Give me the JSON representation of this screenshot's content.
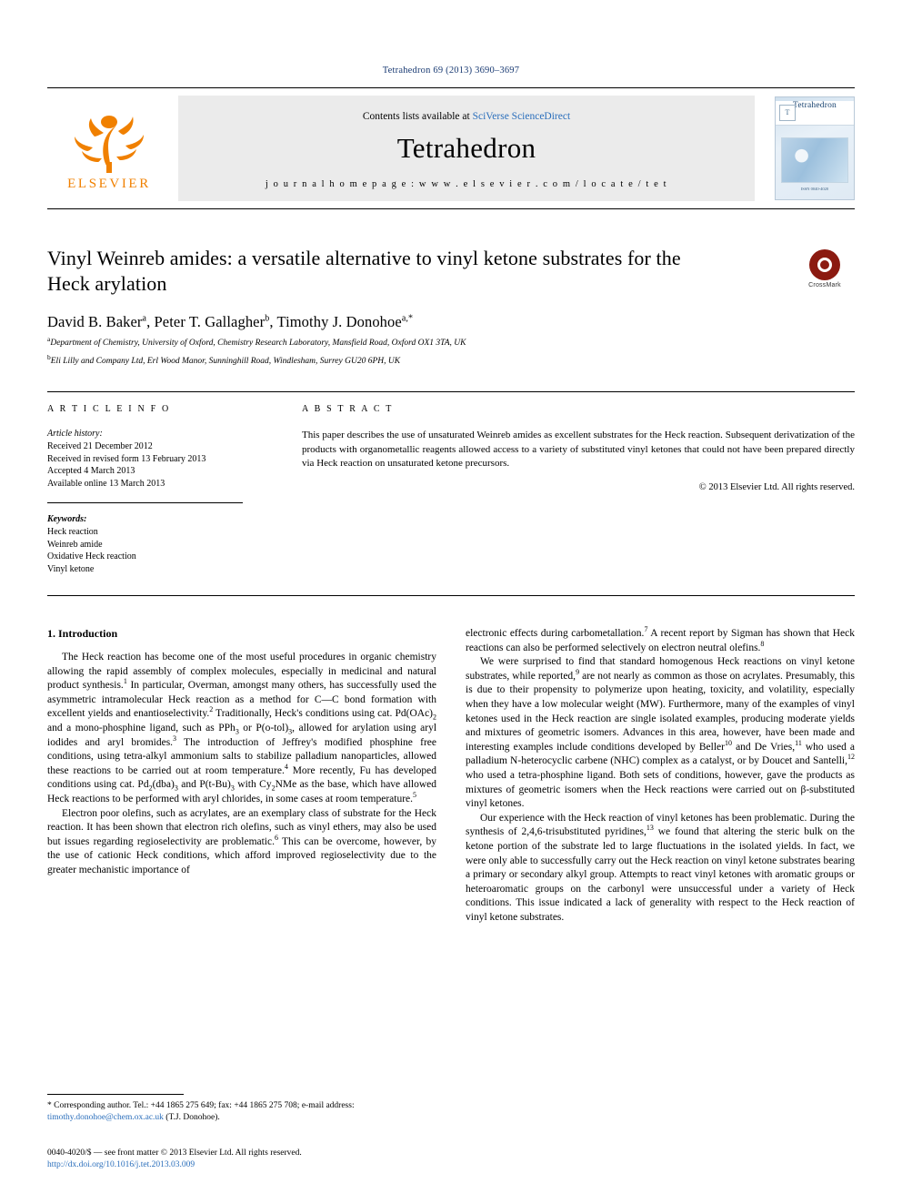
{
  "running_head": "Tetrahedron 69 (2013) 3690–3697",
  "masthead": {
    "publisher": "ELSEVIER",
    "contents_prefix": "Contents lists available at ",
    "contents_link": "SciVerse ScienceDirect",
    "journal": "Tetrahedron",
    "homepage": "j o u r n a l   h o m e p a g e :   w w w . e l s e v i e r . c o m / l o c a t e / t e t",
    "cover_title": "Tetrahedron",
    "cover_logo": "T",
    "cover_footer": "ISSN 0040-4020"
  },
  "article": {
    "title": "Vinyl Weinreb amides: a versatile alternative to vinyl ketone substrates for the Heck arylation",
    "crossmark_label": "CrossMark",
    "authors_html": "David B. Baker<sup>a</sup>, Peter T. Gallagher<sup>b</sup>, Timothy J. Donohoe<sup>a,</sup><sup>*</sup>",
    "affiliations": [
      "a Department of Chemistry, University of Oxford, Chemistry Research Laboratory, Mansfield Road, Oxford OX1 3TA, UK",
      "b Eli Lilly and Company Ltd, Erl Wood Manor, Sunninghill Road, Windlesham, Surrey GU20 6PH, UK"
    ],
    "affiliation_marks": [
      "a",
      "b"
    ]
  },
  "info": {
    "heading": "A R T I C L E   I N F O",
    "history_title": "Article history:",
    "history": [
      "Received 21 December 2012",
      "Received in revised form 13 February 2013",
      "Accepted 4 March 2013",
      "Available online 13 March 2013"
    ],
    "keywords_title": "Keywords:",
    "keywords": [
      "Heck reaction",
      "Weinreb amide",
      "Oxidative Heck reaction",
      "Vinyl ketone"
    ]
  },
  "abstract": {
    "heading": "A B S T R A C T",
    "text": "This paper describes the use of unsaturated Weinreb amides as excellent substrates for the Heck reaction. Subsequent derivatization of the products with organometallic reagents allowed access to a variety of substituted vinyl ketones that could not have been prepared directly via Heck reaction on unsaturated ketone precursors.",
    "copyright": "© 2013 Elsevier Ltd. All rights reserved."
  },
  "body": {
    "section_title": "1.  Introduction",
    "left_paragraphs": [
      "The Heck reaction has become one of the most useful procedures in organic chemistry allowing the rapid assembly of complex molecules, especially in medicinal and natural product synthesis.<sup>1</sup> In particular, Overman, amongst many others, has successfully used the asymmetric intramolecular Heck reaction as a method for C—C bond formation with excellent yields and enantioselectivity.<sup>2</sup> Traditionally, Heck's conditions using cat. Pd(OAc)<sub>2</sub> and a mono-phosphine ligand, such as PPh<sub>3</sub> or P(o-tol)<sub>3</sub>, allowed for arylation using aryl iodides and aryl bromides.<sup>3</sup> The introduction of Jeffrey's modified phosphine free conditions, using tetra-alkyl ammonium salts to stabilize palladium nanoparticles, allowed these reactions to be carried out at room temperature.<sup>4</sup> More recently, Fu has developed conditions using cat. Pd<sub>2</sub>(dba)<sub>3</sub> and P(t-Bu)<sub>3</sub> with Cy<sub>2</sub>NMe as the base, which have allowed Heck reactions to be performed with aryl chlorides, in some cases at room temperature.<sup>5</sup>",
      "Electron poor olefins, such as acrylates, are an exemplary class of substrate for the Heck reaction. It has been shown that electron rich olefins, such as vinyl ethers, may also be used but issues regarding regioselectivity are problematic.<sup>6</sup> This can be overcome, however, by the use of cationic Heck conditions, which afford improved regioselectivity due to the greater mechanistic importance of"
    ],
    "right_paragraphs": [
      "electronic effects during carbometallation.<sup>7</sup> A recent report by Sigman has shown that Heck reactions can also be performed selectively on electron neutral olefins.<sup>8</sup>",
      "We were surprised to find that standard homogenous Heck reactions on vinyl ketone substrates, while reported,<sup>9</sup> are not nearly as common as those on acrylates. Presumably, this is due to their propensity to polymerize upon heating, toxicity, and volatility, especially when they have a low molecular weight (MW). Furthermore, many of the examples of vinyl ketones used in the Heck reaction are single isolated examples, producing moderate yields and mixtures of geometric isomers. Advances in this area, however, have been made and interesting examples include conditions developed by Beller<sup>10</sup> and De Vries,<sup>11</sup> who used a palladium N-heterocyclic carbene (NHC) complex as a catalyst, or by Doucet and Santelli,<sup>12</sup> who used a tetra-phosphine ligand. Both sets of conditions, however, gave the products as mixtures of geometric isomers when the Heck reactions were carried out on β-substituted vinyl ketones.",
      "Our experience with the Heck reaction of vinyl ketones has been problematic. During the synthesis of 2,4,6-trisubstituted pyridines,<sup>13</sup> we found that altering the steric bulk on the ketone portion of the substrate led to large fluctuations in the isolated yields. In fact, we were only able to successfully carry out the Heck reaction on vinyl ketone substrates bearing a primary or secondary alkyl group. Attempts to react vinyl ketones with aromatic groups or heteroaromatic groups on the carbonyl were unsuccessful under a variety of Heck conditions. This issue indicated a lack of generality with respect to the Heck reaction of vinyl ketone substrates."
    ]
  },
  "footnote": {
    "text_before_email": "* Corresponding author. Tel.: +44 1865 275 649; fax: +44 1865 275 708; e-mail address: ",
    "email": "timothy.donohoe@chem.ox.ac.uk",
    "text_after_email": " (T.J. Donohoe)."
  },
  "footer": {
    "line1": "0040-4020/$ — see front matter © 2013 Elsevier Ltd. All rights reserved.",
    "line2": "http://dx.doi.org/10.1016/j.tet.2013.03.009"
  },
  "colors": {
    "link_blue": "#2a6ebb",
    "running_head_blue": "#1a3b73",
    "elsevier_orange": "#f08000",
    "crossmark_red": "#8b1a10"
  }
}
